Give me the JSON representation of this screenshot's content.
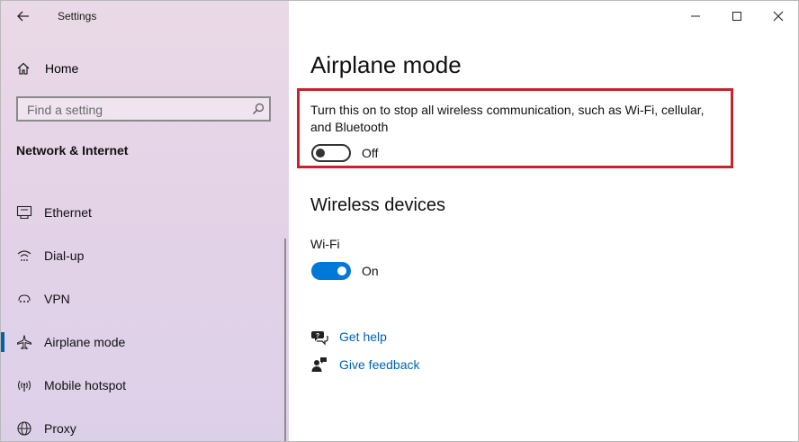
{
  "window": {
    "title": "Settings"
  },
  "sidebar": {
    "home_label": "Home",
    "search_placeholder": "Find a setting",
    "section_title": "Network & Internet",
    "items": [
      {
        "label": "Ethernet",
        "icon": "ethernet-icon"
      },
      {
        "label": "Dial-up",
        "icon": "dial-up-icon"
      },
      {
        "label": "VPN",
        "icon": "vpn-icon"
      },
      {
        "label": "Airplane mode",
        "icon": "airplane-icon",
        "selected": true
      },
      {
        "label": "Mobile hotspot",
        "icon": "mobile-hotspot-icon"
      },
      {
        "label": "Proxy",
        "icon": "proxy-globe-icon"
      }
    ]
  },
  "main": {
    "title": "Airplane mode",
    "airplane": {
      "description": "Turn this on to stop all wireless communication, such as Wi-Fi, cellular, and Bluetooth",
      "toggle_state": "Off"
    },
    "wireless_title": "Wireless devices",
    "wifi": {
      "label": "Wi-Fi",
      "toggle_state": "On"
    },
    "links": {
      "help": "Get help",
      "feedback": "Give feedback"
    }
  },
  "colors": {
    "accent": "#0078d7",
    "highlight_box": "#c8232c",
    "link": "#0063b1"
  }
}
